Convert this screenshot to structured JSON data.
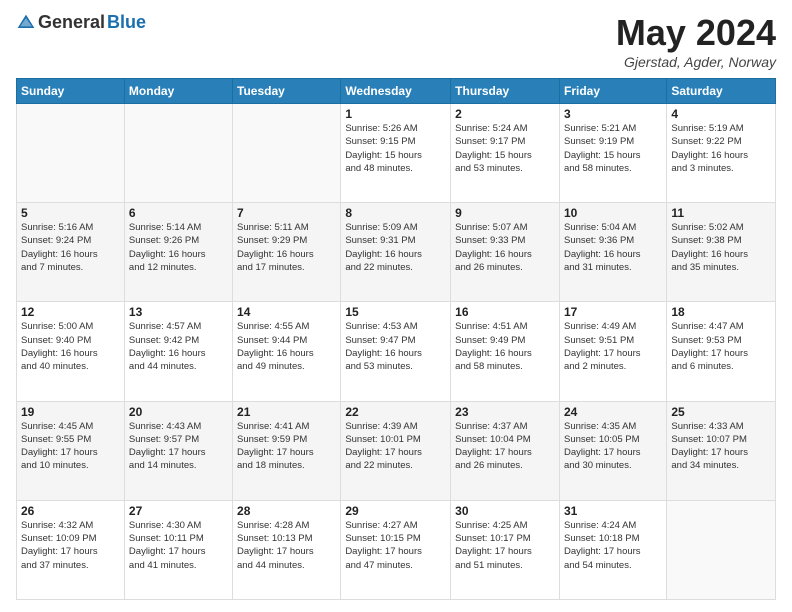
{
  "logo": {
    "general": "General",
    "blue": "Blue"
  },
  "title": "May 2024",
  "location": "Gjerstad, Agder, Norway",
  "days_header": [
    "Sunday",
    "Monday",
    "Tuesday",
    "Wednesday",
    "Thursday",
    "Friday",
    "Saturday"
  ],
  "weeks": [
    [
      {
        "day": "",
        "info": ""
      },
      {
        "day": "",
        "info": ""
      },
      {
        "day": "",
        "info": ""
      },
      {
        "day": "1",
        "info": "Sunrise: 5:26 AM\nSunset: 9:15 PM\nDaylight: 15 hours\nand 48 minutes."
      },
      {
        "day": "2",
        "info": "Sunrise: 5:24 AM\nSunset: 9:17 PM\nDaylight: 15 hours\nand 53 minutes."
      },
      {
        "day": "3",
        "info": "Sunrise: 5:21 AM\nSunset: 9:19 PM\nDaylight: 15 hours\nand 58 minutes."
      },
      {
        "day": "4",
        "info": "Sunrise: 5:19 AM\nSunset: 9:22 PM\nDaylight: 16 hours\nand 3 minutes."
      }
    ],
    [
      {
        "day": "5",
        "info": "Sunrise: 5:16 AM\nSunset: 9:24 PM\nDaylight: 16 hours\nand 7 minutes."
      },
      {
        "day": "6",
        "info": "Sunrise: 5:14 AM\nSunset: 9:26 PM\nDaylight: 16 hours\nand 12 minutes."
      },
      {
        "day": "7",
        "info": "Sunrise: 5:11 AM\nSunset: 9:29 PM\nDaylight: 16 hours\nand 17 minutes."
      },
      {
        "day": "8",
        "info": "Sunrise: 5:09 AM\nSunset: 9:31 PM\nDaylight: 16 hours\nand 22 minutes."
      },
      {
        "day": "9",
        "info": "Sunrise: 5:07 AM\nSunset: 9:33 PM\nDaylight: 16 hours\nand 26 minutes."
      },
      {
        "day": "10",
        "info": "Sunrise: 5:04 AM\nSunset: 9:36 PM\nDaylight: 16 hours\nand 31 minutes."
      },
      {
        "day": "11",
        "info": "Sunrise: 5:02 AM\nSunset: 9:38 PM\nDaylight: 16 hours\nand 35 minutes."
      }
    ],
    [
      {
        "day": "12",
        "info": "Sunrise: 5:00 AM\nSunset: 9:40 PM\nDaylight: 16 hours\nand 40 minutes."
      },
      {
        "day": "13",
        "info": "Sunrise: 4:57 AM\nSunset: 9:42 PM\nDaylight: 16 hours\nand 44 minutes."
      },
      {
        "day": "14",
        "info": "Sunrise: 4:55 AM\nSunset: 9:44 PM\nDaylight: 16 hours\nand 49 minutes."
      },
      {
        "day": "15",
        "info": "Sunrise: 4:53 AM\nSunset: 9:47 PM\nDaylight: 16 hours\nand 53 minutes."
      },
      {
        "day": "16",
        "info": "Sunrise: 4:51 AM\nSunset: 9:49 PM\nDaylight: 16 hours\nand 58 minutes."
      },
      {
        "day": "17",
        "info": "Sunrise: 4:49 AM\nSunset: 9:51 PM\nDaylight: 17 hours\nand 2 minutes."
      },
      {
        "day": "18",
        "info": "Sunrise: 4:47 AM\nSunset: 9:53 PM\nDaylight: 17 hours\nand 6 minutes."
      }
    ],
    [
      {
        "day": "19",
        "info": "Sunrise: 4:45 AM\nSunset: 9:55 PM\nDaylight: 17 hours\nand 10 minutes."
      },
      {
        "day": "20",
        "info": "Sunrise: 4:43 AM\nSunset: 9:57 PM\nDaylight: 17 hours\nand 14 minutes."
      },
      {
        "day": "21",
        "info": "Sunrise: 4:41 AM\nSunset: 9:59 PM\nDaylight: 17 hours\nand 18 minutes."
      },
      {
        "day": "22",
        "info": "Sunrise: 4:39 AM\nSunset: 10:01 PM\nDaylight: 17 hours\nand 22 minutes."
      },
      {
        "day": "23",
        "info": "Sunrise: 4:37 AM\nSunset: 10:04 PM\nDaylight: 17 hours\nand 26 minutes."
      },
      {
        "day": "24",
        "info": "Sunrise: 4:35 AM\nSunset: 10:05 PM\nDaylight: 17 hours\nand 30 minutes."
      },
      {
        "day": "25",
        "info": "Sunrise: 4:33 AM\nSunset: 10:07 PM\nDaylight: 17 hours\nand 34 minutes."
      }
    ],
    [
      {
        "day": "26",
        "info": "Sunrise: 4:32 AM\nSunset: 10:09 PM\nDaylight: 17 hours\nand 37 minutes."
      },
      {
        "day": "27",
        "info": "Sunrise: 4:30 AM\nSunset: 10:11 PM\nDaylight: 17 hours\nand 41 minutes."
      },
      {
        "day": "28",
        "info": "Sunrise: 4:28 AM\nSunset: 10:13 PM\nDaylight: 17 hours\nand 44 minutes."
      },
      {
        "day": "29",
        "info": "Sunrise: 4:27 AM\nSunset: 10:15 PM\nDaylight: 17 hours\nand 47 minutes."
      },
      {
        "day": "30",
        "info": "Sunrise: 4:25 AM\nSunset: 10:17 PM\nDaylight: 17 hours\nand 51 minutes."
      },
      {
        "day": "31",
        "info": "Sunrise: 4:24 AM\nSunset: 10:18 PM\nDaylight: 17 hours\nand 54 minutes."
      },
      {
        "day": "",
        "info": ""
      }
    ]
  ]
}
